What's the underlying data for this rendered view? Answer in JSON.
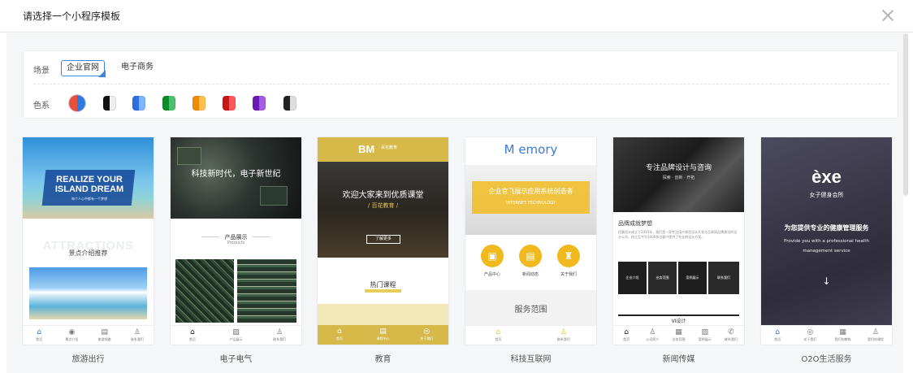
{
  "title": "请选择一个小程序模板",
  "filters": {
    "scene_label": "场景",
    "scenes": [
      "企业官网",
      "电子商务"
    ],
    "color_label": "色系",
    "swatches": [
      "linear-gradient(90deg,#e94e3b 50%,#2b7ae4 50%)",
      "linear-gradient(90deg,#111 50%,#eee 50%)",
      "linear-gradient(90deg,#2b6fe0 50%,#7fb3ff 50%)",
      "linear-gradient(90deg,#0f8a2b 50%,#4cc36a 50%)",
      "linear-gradient(90deg,#f08a00 50%,#ffc04d 50%)",
      "linear-gradient(90deg,#c4161c 50%,#ff5a5a 50%)",
      "linear-gradient(90deg,#6a1bb3 50%,#a45de0 50%)",
      "linear-gradient(90deg,#222 50%,#ddd 50%)"
    ]
  },
  "templates": [
    {
      "name": "旅游出行",
      "banner_line1": "REALIZE YOUR",
      "banner_line2": "ISLAND DREAM",
      "banner_sub": "每个人心中都有一个梦想",
      "watermark": "ATTRACTIONS",
      "section": "景点介绍推荐",
      "nav": [
        "首页",
        "景点介绍",
        "旅游线路",
        "联系我们"
      ]
    },
    {
      "name": "电子电气",
      "banner_title": "科技新时代，电子新世纪",
      "section": "产品展示",
      "section_en": "Products",
      "nav": [
        "首页",
        "产品展示",
        "联系我们"
      ]
    },
    {
      "name": "教育",
      "logo": "BM",
      "logo_text": "百花教育",
      "headline": "欢迎大家来到优质课堂",
      "sub": "/ 百花教育 /",
      "more": "了解更多",
      "section": "热门课程",
      "nav": [
        "首页",
        "课程中心",
        "关于我们"
      ]
    },
    {
      "name": "科技互联网",
      "logo": "M emory",
      "headline": "企业官飞展示应用系统创造者",
      "sub": "INTERNET TECHNOLOGY",
      "icons": [
        "产品中心",
        "新闻动态",
        "关于我们"
      ],
      "section": "服务范围",
      "nav": [
        "首页",
        "联系我们"
      ]
    },
    {
      "name": "新闻传媒",
      "headline": "专注品牌设计与咨询",
      "tags": "探索 · 创新 · 开拓",
      "section": "品牌成就梦想",
      "body": "优最设计成立于2015年，我们是一家专注用户体验设计开发与互联网品牌建设的设计公司，创立至今为1000多位客户提供了专业的设计方案。",
      "tiles": [
        "企业介绍",
        "业务范围",
        "案例展示",
        "联系我们"
      ],
      "section2": "VI设计",
      "nav": [
        "首页",
        "公司简介",
        "业务范围",
        "案例展示",
        "联系我们"
      ]
    },
    {
      "name": "O2O生活服务",
      "logo": "èxe",
      "logo_sub": "女子健身会所",
      "headline": "为您提供专业的健康管理服务",
      "sub": "Provide you with a professional health management service",
      "nav": [
        "首页",
        "关于我们",
        "我们的教练",
        "我们的课程"
      ]
    }
  ]
}
